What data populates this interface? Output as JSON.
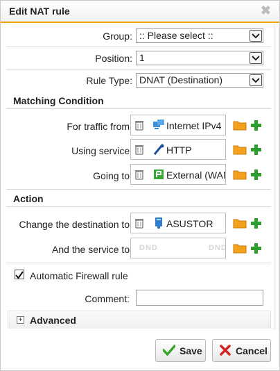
{
  "dialog": {
    "title": "Edit NAT rule",
    "close_symbol": "✖"
  },
  "fields": {
    "group": {
      "label": "Group:",
      "value": ":: Please select ::"
    },
    "position": {
      "label": "Position:",
      "value": "1"
    },
    "rule_type": {
      "label": "Rule Type:",
      "value": "DNAT (Destination)"
    }
  },
  "matching": {
    "heading": "Matching Condition",
    "traffic_from": {
      "label": "For traffic from:",
      "value": "Internet IPv4",
      "icon": "network-icon"
    },
    "using_service": {
      "label": "Using service:",
      "value": "HTTP",
      "icon": "service-icon"
    },
    "going_to": {
      "label": "Going to:",
      "value": "External (WAN)",
      "icon": "interface-icon"
    }
  },
  "action": {
    "heading": "Action",
    "change_destination": {
      "label": "Change the destination to:",
      "value": "ASUSTOR",
      "icon": "host-icon"
    },
    "and_service": {
      "label": "And the service to:",
      "placeholder_left": "DND",
      "placeholder_right": "DND"
    }
  },
  "auto_firewall": {
    "label": "Automatic Firewall rule",
    "checked": true
  },
  "comment": {
    "label": "Comment:",
    "value": ""
  },
  "advanced": {
    "label": "Advanced",
    "expand_symbol": "+"
  },
  "buttons": {
    "save": "Save",
    "cancel": "Cancel"
  },
  "colors": {
    "accent": "#f0a30a",
    "save_green": "#3aa32c",
    "cancel_red": "#d32222",
    "plus_green": "#2e9e2e",
    "folder_orange": "#f4a21d"
  }
}
